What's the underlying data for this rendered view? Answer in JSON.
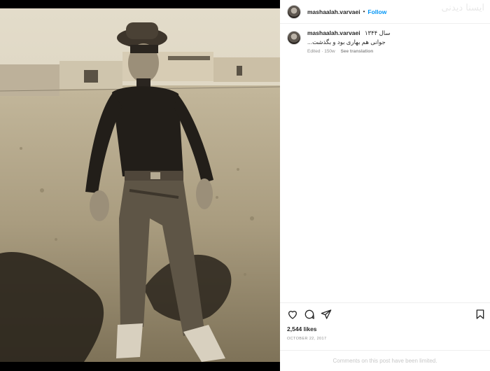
{
  "post": {
    "username": "mashaalah.varvaei",
    "follow_label": "Follow",
    "separator": "•",
    "watermark": "ایسنا دیدنی",
    "caption": {
      "username": "mashaalah.varvaei",
      "line1": "سال ۱۳۴۴",
      "line2": "جوانی هم بهاری بود و بگذشت...",
      "edited": "Edited · 150w",
      "see_translation": "See translation"
    },
    "likes": "2,544 likes",
    "date": "OCTOBER 22, 2017",
    "comments_limited": "Comments on this post have been limited."
  },
  "icons": {
    "like": "heart-icon",
    "comment": "comment-icon",
    "share": "paper-plane-icon",
    "save": "bookmark-icon"
  },
  "colors": {
    "accent": "#0095f6",
    "text": "#262626",
    "muted": "#8e8e8e",
    "border": "#efefef"
  }
}
